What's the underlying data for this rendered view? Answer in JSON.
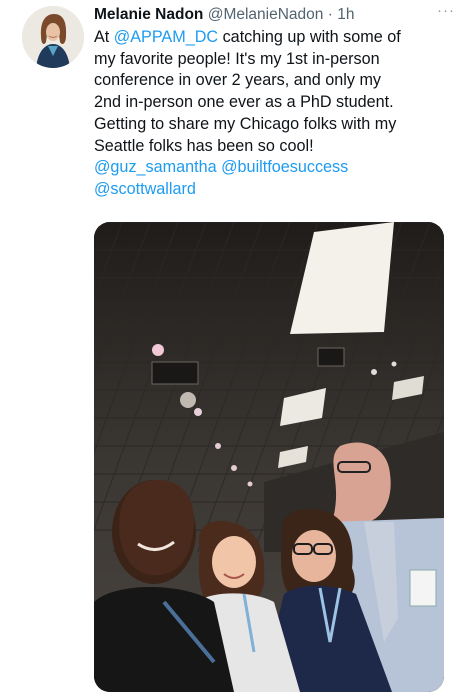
{
  "tweet": {
    "author_name": "Melanie Nadon",
    "author_handle": "@MelanieNadon",
    "separator": "·",
    "timestamp": "1h",
    "more_label": "···",
    "text_lines": {
      "l1_prefix": "At ",
      "l1_mention": "@APPAM_DC",
      "l1_suffix": " catching up with some of",
      "l2": "my favorite people! It's my 1st in-person",
      "l3": "conference in over 2 years, and only my",
      "l4": "2nd in-person one ever as a PhD student.",
      "l5": "Getting to share my Chicago folks with my",
      "l6": "Seattle folks has been so cool!"
    },
    "mentions": [
      "@guz_samantha",
      "@builtfoesuccess",
      "@scottwallard"
    ]
  },
  "colors": {
    "link": "#1d9bf0",
    "text": "#0f1419",
    "secondary": "#536471"
  },
  "icons": {
    "more": "more-horizontal-icon"
  }
}
